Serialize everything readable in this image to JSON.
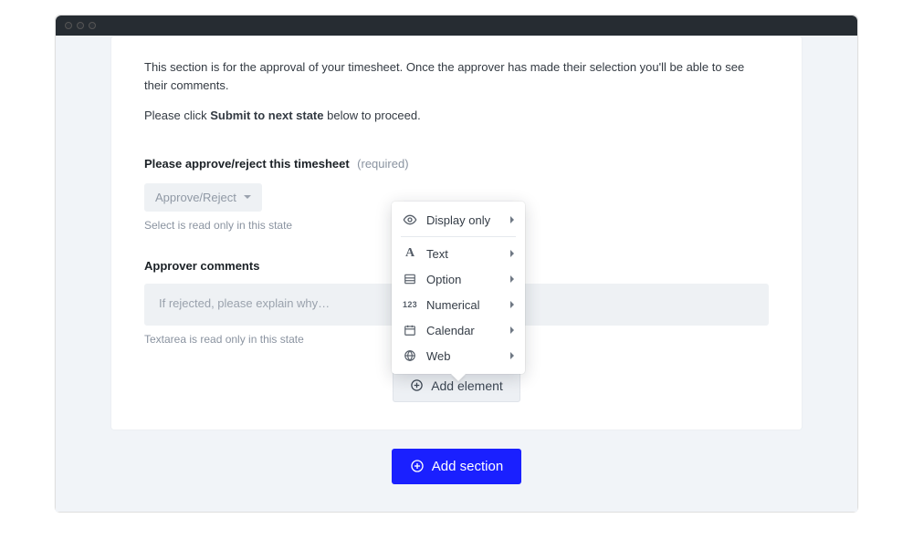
{
  "intro": {
    "line1": "This section is for the approval of your timesheet. Once the approver has made their selection you'll be able to see their comments.",
    "line2_prefix": "Please click ",
    "line2_bold": "Submit to next state",
    "line2_suffix": " below to proceed."
  },
  "field1": {
    "label": "Please approve/reject this timesheet",
    "required": "(required)",
    "select_value": "Approve/Reject",
    "helper": "Select is read only in this state"
  },
  "field2": {
    "label": "Approver comments",
    "placeholder": "If rejected, please explain why…",
    "helper": "Textarea is read only in this state"
  },
  "buttons": {
    "add_element": "Add element",
    "add_section": "Add section"
  },
  "popover": {
    "items": [
      {
        "label": "Display only"
      },
      {
        "label": "Text"
      },
      {
        "label": "Option"
      },
      {
        "label": "Numerical"
      },
      {
        "label": "Calendar"
      },
      {
        "label": "Web"
      }
    ]
  }
}
